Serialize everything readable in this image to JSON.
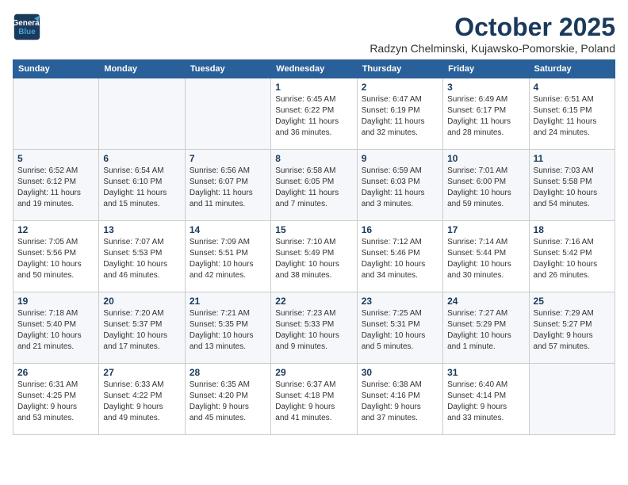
{
  "logo": {
    "line1": "General",
    "line2": "Blue"
  },
  "title": "October 2025",
  "subtitle": "Radzyn Chelminski, Kujawsko-Pomorskie, Poland",
  "weekdays": [
    "Sunday",
    "Monday",
    "Tuesday",
    "Wednesday",
    "Thursday",
    "Friday",
    "Saturday"
  ],
  "weeks": [
    [
      {
        "day": "",
        "info": ""
      },
      {
        "day": "",
        "info": ""
      },
      {
        "day": "",
        "info": ""
      },
      {
        "day": "1",
        "info": "Sunrise: 6:45 AM\nSunset: 6:22 PM\nDaylight: 11 hours\nand 36 minutes."
      },
      {
        "day": "2",
        "info": "Sunrise: 6:47 AM\nSunset: 6:19 PM\nDaylight: 11 hours\nand 32 minutes."
      },
      {
        "day": "3",
        "info": "Sunrise: 6:49 AM\nSunset: 6:17 PM\nDaylight: 11 hours\nand 28 minutes."
      },
      {
        "day": "4",
        "info": "Sunrise: 6:51 AM\nSunset: 6:15 PM\nDaylight: 11 hours\nand 24 minutes."
      }
    ],
    [
      {
        "day": "5",
        "info": "Sunrise: 6:52 AM\nSunset: 6:12 PM\nDaylight: 11 hours\nand 19 minutes."
      },
      {
        "day": "6",
        "info": "Sunrise: 6:54 AM\nSunset: 6:10 PM\nDaylight: 11 hours\nand 15 minutes."
      },
      {
        "day": "7",
        "info": "Sunrise: 6:56 AM\nSunset: 6:07 PM\nDaylight: 11 hours\nand 11 minutes."
      },
      {
        "day": "8",
        "info": "Sunrise: 6:58 AM\nSunset: 6:05 PM\nDaylight: 11 hours\nand 7 minutes."
      },
      {
        "day": "9",
        "info": "Sunrise: 6:59 AM\nSunset: 6:03 PM\nDaylight: 11 hours\nand 3 minutes."
      },
      {
        "day": "10",
        "info": "Sunrise: 7:01 AM\nSunset: 6:00 PM\nDaylight: 10 hours\nand 59 minutes."
      },
      {
        "day": "11",
        "info": "Sunrise: 7:03 AM\nSunset: 5:58 PM\nDaylight: 10 hours\nand 54 minutes."
      }
    ],
    [
      {
        "day": "12",
        "info": "Sunrise: 7:05 AM\nSunset: 5:56 PM\nDaylight: 10 hours\nand 50 minutes."
      },
      {
        "day": "13",
        "info": "Sunrise: 7:07 AM\nSunset: 5:53 PM\nDaylight: 10 hours\nand 46 minutes."
      },
      {
        "day": "14",
        "info": "Sunrise: 7:09 AM\nSunset: 5:51 PM\nDaylight: 10 hours\nand 42 minutes."
      },
      {
        "day": "15",
        "info": "Sunrise: 7:10 AM\nSunset: 5:49 PM\nDaylight: 10 hours\nand 38 minutes."
      },
      {
        "day": "16",
        "info": "Sunrise: 7:12 AM\nSunset: 5:46 PM\nDaylight: 10 hours\nand 34 minutes."
      },
      {
        "day": "17",
        "info": "Sunrise: 7:14 AM\nSunset: 5:44 PM\nDaylight: 10 hours\nand 30 minutes."
      },
      {
        "day": "18",
        "info": "Sunrise: 7:16 AM\nSunset: 5:42 PM\nDaylight: 10 hours\nand 26 minutes."
      }
    ],
    [
      {
        "day": "19",
        "info": "Sunrise: 7:18 AM\nSunset: 5:40 PM\nDaylight: 10 hours\nand 21 minutes."
      },
      {
        "day": "20",
        "info": "Sunrise: 7:20 AM\nSunset: 5:37 PM\nDaylight: 10 hours\nand 17 minutes."
      },
      {
        "day": "21",
        "info": "Sunrise: 7:21 AM\nSunset: 5:35 PM\nDaylight: 10 hours\nand 13 minutes."
      },
      {
        "day": "22",
        "info": "Sunrise: 7:23 AM\nSunset: 5:33 PM\nDaylight: 10 hours\nand 9 minutes."
      },
      {
        "day": "23",
        "info": "Sunrise: 7:25 AM\nSunset: 5:31 PM\nDaylight: 10 hours\nand 5 minutes."
      },
      {
        "day": "24",
        "info": "Sunrise: 7:27 AM\nSunset: 5:29 PM\nDaylight: 10 hours\nand 1 minute."
      },
      {
        "day": "25",
        "info": "Sunrise: 7:29 AM\nSunset: 5:27 PM\nDaylight: 9 hours\nand 57 minutes."
      }
    ],
    [
      {
        "day": "26",
        "info": "Sunrise: 6:31 AM\nSunset: 4:25 PM\nDaylight: 9 hours\nand 53 minutes."
      },
      {
        "day": "27",
        "info": "Sunrise: 6:33 AM\nSunset: 4:22 PM\nDaylight: 9 hours\nand 49 minutes."
      },
      {
        "day": "28",
        "info": "Sunrise: 6:35 AM\nSunset: 4:20 PM\nDaylight: 9 hours\nand 45 minutes."
      },
      {
        "day": "29",
        "info": "Sunrise: 6:37 AM\nSunset: 4:18 PM\nDaylight: 9 hours\nand 41 minutes."
      },
      {
        "day": "30",
        "info": "Sunrise: 6:38 AM\nSunset: 4:16 PM\nDaylight: 9 hours\nand 37 minutes."
      },
      {
        "day": "31",
        "info": "Sunrise: 6:40 AM\nSunset: 4:14 PM\nDaylight: 9 hours\nand 33 minutes."
      },
      {
        "day": "",
        "info": ""
      }
    ]
  ]
}
